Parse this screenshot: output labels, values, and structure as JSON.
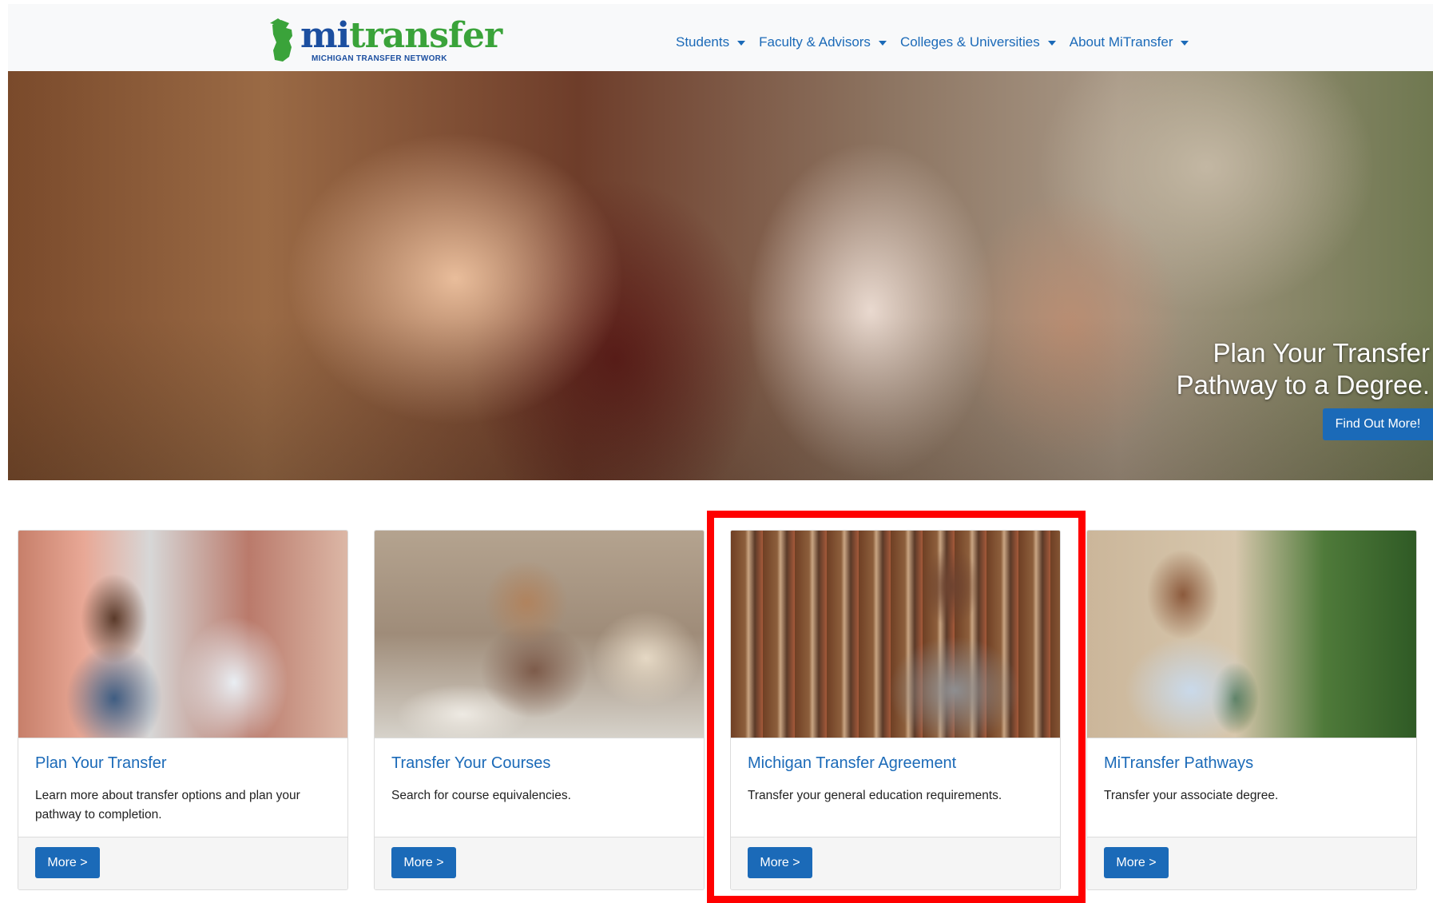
{
  "header": {
    "logo": {
      "word_part1": "mi",
      "word_part2": "transfer",
      "tagline": "MICHIGAN TRANSFER NETWORK"
    },
    "nav": [
      {
        "label": "Students"
      },
      {
        "label": "Faculty & Advisors"
      },
      {
        "label": "Colleges & Universities"
      },
      {
        "label": "About MiTransfer"
      }
    ]
  },
  "hero": {
    "caption_line1": "Plan Your Transfer",
    "caption_line2": "Pathway to a Degree.",
    "button_label": "Find Out More!"
  },
  "cards": [
    {
      "title": "Plan Your Transfer",
      "text": "Learn more about transfer options and plan your pathway to completion.",
      "button_label": "More >"
    },
    {
      "title": "Transfer Your Courses",
      "text": "Search for course equivalencies.",
      "button_label": "More >"
    },
    {
      "title": "Michigan Transfer Agreement",
      "text": "Transfer your general education requirements.",
      "button_label": "More >"
    },
    {
      "title": "MiTransfer Pathways",
      "text": "Transfer your associate degree.",
      "button_label": "More >"
    }
  ],
  "colors": {
    "accent": "#1b6ab8",
    "logo_blue": "#1c4fa0",
    "logo_green": "#3aa33a",
    "highlight": "#ff0000"
  }
}
